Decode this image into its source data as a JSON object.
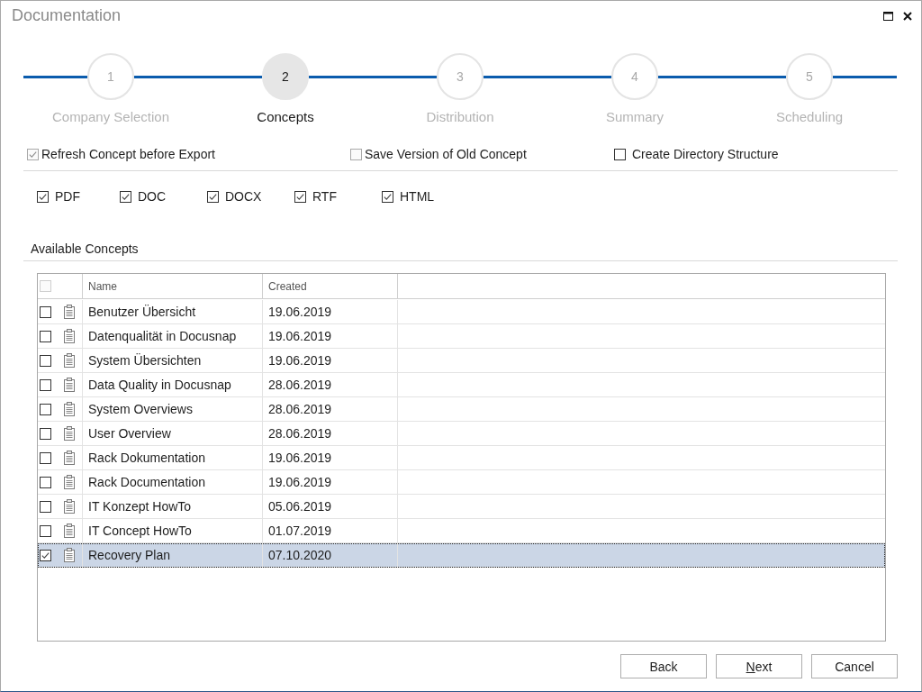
{
  "window": {
    "title": "Documentation"
  },
  "steps": [
    {
      "number": "1",
      "label": "Company Selection",
      "selected": false
    },
    {
      "number": "2",
      "label": "Concepts",
      "selected": true
    },
    {
      "number": "3",
      "label": "Distribution",
      "selected": false
    },
    {
      "number": "4",
      "label": "Summary",
      "selected": false
    },
    {
      "number": "5",
      "label": "Scheduling",
      "selected": false
    }
  ],
  "options": [
    {
      "label": "Refresh Concept before Export",
      "checked": true,
      "disabled": true
    },
    {
      "label": "Save Version of Old Concept",
      "checked": false,
      "disabled": true
    },
    {
      "label": "Create Directory Structure",
      "checked": false,
      "disabled": false
    }
  ],
  "formats": [
    {
      "label": "PDF",
      "checked": true
    },
    {
      "label": "DOC",
      "checked": true
    },
    {
      "label": "DOCX",
      "checked": true
    },
    {
      "label": "RTF",
      "checked": true
    },
    {
      "label": "HTML",
      "checked": true
    }
  ],
  "concepts": {
    "title": "Available Concepts",
    "header_checkbox": {
      "checked": false,
      "disabled": true
    },
    "columns": [
      "Name",
      "Created"
    ],
    "rows": [
      {
        "name": "Benutzer Übersicht",
        "created": "19.06.2019",
        "checked": false,
        "selected": false
      },
      {
        "name": "Datenqualität in Docusnap",
        "created": "19.06.2019",
        "checked": false,
        "selected": false
      },
      {
        "name": "System Übersichten",
        "created": "19.06.2019",
        "checked": false,
        "selected": false
      },
      {
        "name": "Data Quality in Docusnap",
        "created": "28.06.2019",
        "checked": false,
        "selected": false
      },
      {
        "name": "System Overviews",
        "created": "28.06.2019",
        "checked": false,
        "selected": false
      },
      {
        "name": "User Overview",
        "created": "28.06.2019",
        "checked": false,
        "selected": false
      },
      {
        "name": "Rack Dokumentation",
        "created": "19.06.2019",
        "checked": false,
        "selected": false
      },
      {
        "name": "Rack Documentation",
        "created": "19.06.2019",
        "checked": false,
        "selected": false
      },
      {
        "name": "IT Konzept HowTo",
        "created": "05.06.2019",
        "checked": false,
        "selected": false
      },
      {
        "name": "IT Concept HowTo",
        "created": "01.07.2019",
        "checked": false,
        "selected": false
      },
      {
        "name": "Recovery Plan",
        "created": "07.10.2020",
        "checked": true,
        "selected": true
      }
    ]
  },
  "buttons": [
    {
      "label": "Back",
      "mnemonic": false
    },
    {
      "label": "Next",
      "mnemonic": true
    },
    {
      "label": "Cancel",
      "mnemonic": false
    }
  ]
}
